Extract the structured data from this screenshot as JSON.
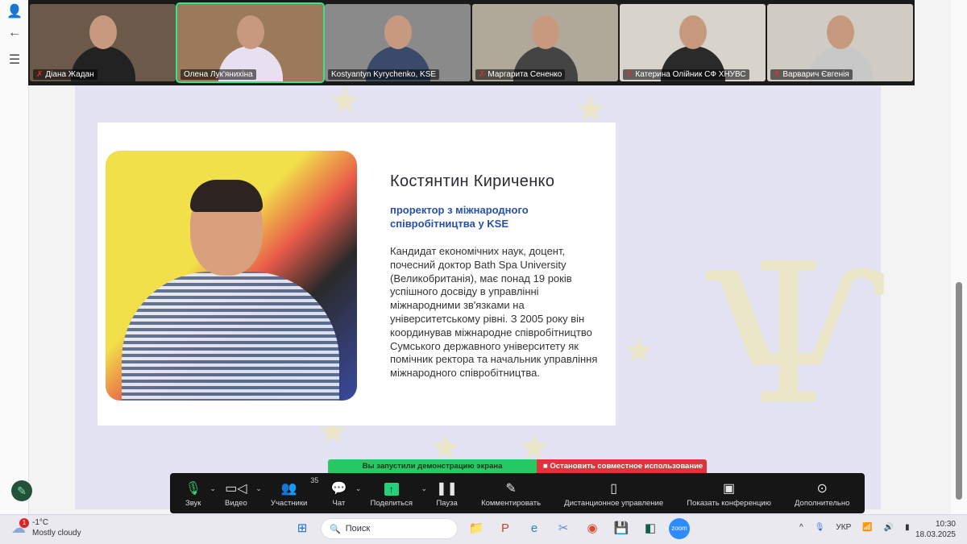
{
  "participants": [
    {
      "name": "Діана Жадан",
      "muted": true,
      "bg": "#6b5a4a",
      "shirt": "#222"
    },
    {
      "name": "Олена Лук'янихіна",
      "muted": false,
      "active": true,
      "bg": "#9a7a5a",
      "shirt": "#e8e0f0"
    },
    {
      "name": "Kostyantyn Kyrychenko, KSE",
      "muted": false,
      "bg": "#8a8a8a",
      "shirt": "#3a4a6a"
    },
    {
      "name": "Маргарита Сененко",
      "muted": true,
      "bg": "#b0a898",
      "shirt": "#444"
    },
    {
      "name": "Катерина Олійник СФ ХНУВС",
      "muted": true,
      "bg": "#d8d4cc",
      "shirt": "#2a2a2a"
    },
    {
      "name": "Варварич Євгенія",
      "muted": true,
      "bg": "#d0ccc4",
      "shirt": "#c8c8c8"
    }
  ],
  "slide": {
    "name": "Костянтин Кириченко",
    "position": "проректор з міжнародного співробітництва у KSE",
    "bio": "Кандидат економічних наук, доцент, почесний доктор Bath Spa University (Великобританія), має понад 19 років успішного досвіду в управлінні міжнародними зв'язками на університетському рівні. З 2005 року він координував міжнародне співробітництво Сумського державного університету як помічник ректора та начальник управління міжнародного співробітництва."
  },
  "share_bar": {
    "status": "Вы запустили демонстрацию экрана",
    "stop": "Остановить совместное использование"
  },
  "toolbar": {
    "audio": "Звук",
    "video": "Видео",
    "participants": "Участники",
    "participants_count": "35",
    "chat": "Чат",
    "share": "Поделиться",
    "pause": "Пауза",
    "annotate": "Комментировать",
    "remote": "Дистанционное управление",
    "show_conf": "Показать конференцию",
    "more": "Дополнительно"
  },
  "taskbar": {
    "weather_badge": "1",
    "temp": "-1°C",
    "weather": "Mostly cloudy",
    "search": "Поиск",
    "lang": "УКР",
    "time": "10:30",
    "date": "18.03.2025"
  }
}
